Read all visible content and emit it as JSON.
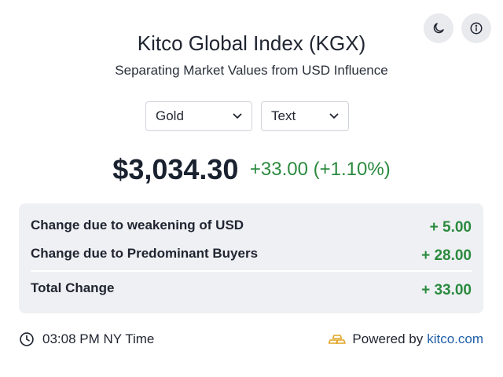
{
  "header": {
    "title": "Kitco Global Index (KGX)",
    "subtitle": "Separating Market Values from USD Influence",
    "theme_button_icon": "moon-icon",
    "info_button_icon": "info-icon"
  },
  "selectors": {
    "metal": "Gold",
    "format": "Text"
  },
  "price": {
    "value": "$3,034.30",
    "change": "+33.00 (+1.10%)"
  },
  "breakdown": {
    "rows": [
      {
        "label": "Change due to weakening of USD",
        "value": "+ 5.00"
      },
      {
        "label": "Change due to Predominant Buyers",
        "value": "+ 28.00"
      }
    ],
    "total": {
      "label": "Total Change",
      "value": "+ 33.00"
    }
  },
  "footer": {
    "time": "03:08 PM NY Time",
    "powered_by": "Powered by",
    "link_text": "kitco.com"
  },
  "colors": {
    "positive": "#2b8a3e",
    "link": "#1f5fa8",
    "panel_bg": "#eef0f3",
    "gold_icon": "#e0a526"
  }
}
